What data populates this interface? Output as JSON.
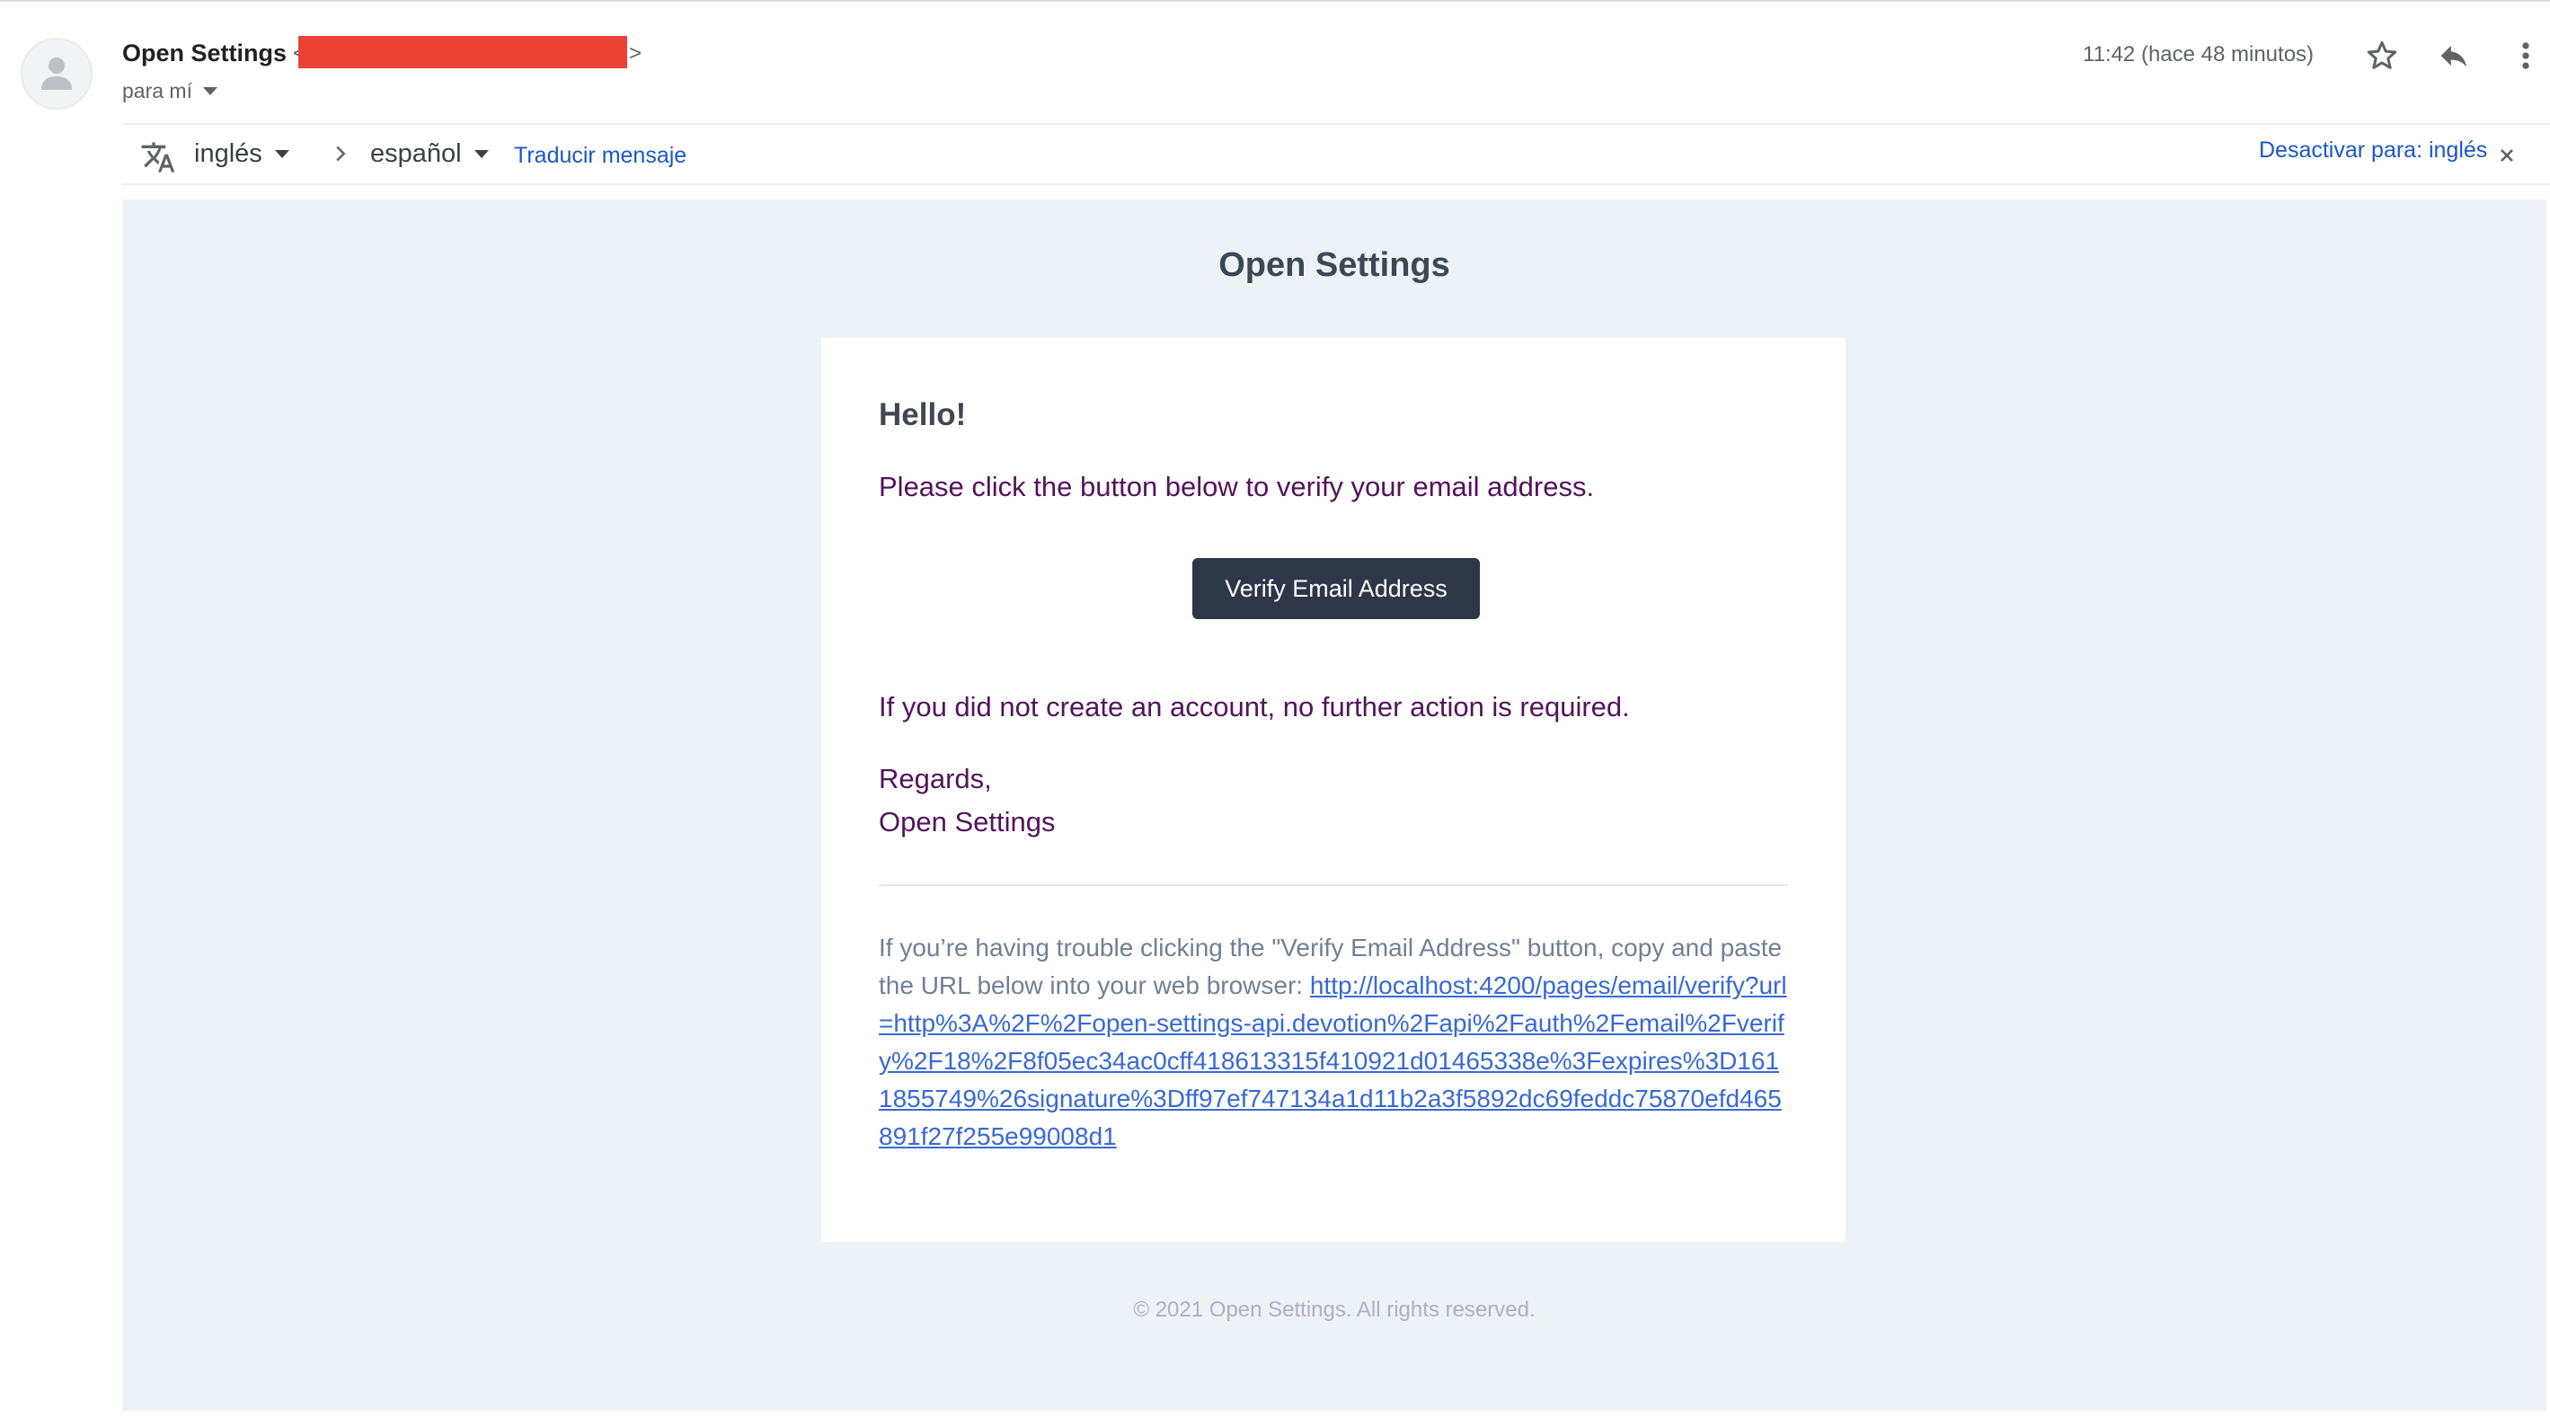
{
  "header": {
    "sender_name": "Open Settings",
    "sender_open": "<",
    "sender_close": ">",
    "recipient": "para mí",
    "timestamp": "11:42 (hace 48 minutos)"
  },
  "translate_bar": {
    "source_lang": "inglés",
    "target_lang": "español",
    "translate_link": "Traducir mensaje",
    "disable_link": "Desactivar para: inglés"
  },
  "email": {
    "brand_title": "Open Settings",
    "greeting": "Hello!",
    "intro": "Please click the button below to verify your email address.",
    "button_label": "Verify Email Address",
    "outro": "If you did not create an account, no further action is required.",
    "salutation": "Regards,",
    "signature": "Open Settings",
    "subcopy_text": "If you’re having trouble clicking the \"Verify Email Address\" button, copy and paste the URL below into your web browser: ",
    "subcopy_url": "http://localhost:4200/pages/email/verify?url=http%3A%2F%2Fopen-settings-api.devotion%2Fapi%2Fauth%2Femail%2Fverify%2F18%2F8f05ec34ac0cff418613315f410921d01465338e%3Fexpires%3D1611855749%26signature%3Dff97ef747134a1d11b2a3f5892dc69feddc75870efd465891f27f255e99008d1",
    "footer": "© 2021 Open Settings. All rights reserved."
  },
  "colors": {
    "accent_link": "#1a57c8",
    "button_bg": "#2d3748",
    "body_text": "#53145b",
    "redaction": "#ea4335"
  },
  "icons": {
    "avatar": "person-icon",
    "star": "star-icon",
    "reply": "reply-icon",
    "more": "more-vert-icon",
    "translate": "translate-icon",
    "arrow": "chevron-right-icon",
    "close": "close-icon"
  }
}
